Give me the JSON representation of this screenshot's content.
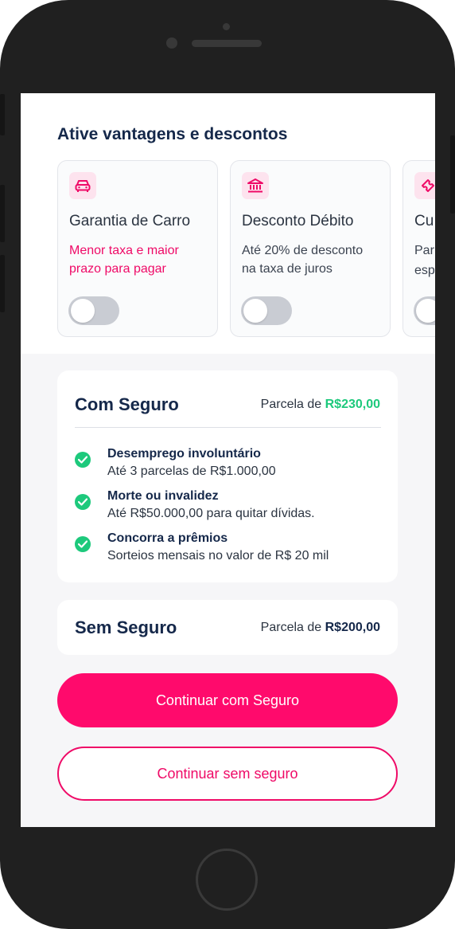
{
  "section": {
    "title": "Ative vantagens e descontos"
  },
  "cards": [
    {
      "icon": "car-icon",
      "title": "Garantia de Carro",
      "desc_line1": "Menor taxa e maior",
      "desc_line2": "prazo para pagar",
      "toggle_on": false
    },
    {
      "icon": "bank-icon",
      "title": "Desconto Débito",
      "desc_line1": "Até 20% de desconto",
      "desc_line2": "na taxa de juros",
      "toggle_on": false
    },
    {
      "icon": "ticket-icon",
      "title": "Cu",
      "desc_line1": "Par",
      "desc_line2": "esp",
      "toggle_on": false
    }
  ],
  "com_seguro": {
    "title": "Com Seguro",
    "price_label": "Parcela de ",
    "price_value": "R$230,00",
    "benefits": [
      {
        "title": "Desemprego involuntário",
        "desc": "Até 3 parcelas de R$1.000,00"
      },
      {
        "title": "Morte ou invalidez",
        "desc": "Até R$50.000,00 para quitar dívidas."
      },
      {
        "title": "Concorra a prêmios",
        "desc": "Sorteios mensais no valor de R$ 20 mil"
      }
    ]
  },
  "sem_seguro": {
    "title": "Sem Seguro",
    "price_label": "Parcela de ",
    "price_value": "R$200,00"
  },
  "buttons": {
    "primary": "Continuar com Seguro",
    "secondary": "Continuar sem seguro"
  },
  "colors": {
    "brand_pink": "#ff0a6c",
    "success_green": "#1dc97c",
    "navy_text": "#15284a"
  }
}
